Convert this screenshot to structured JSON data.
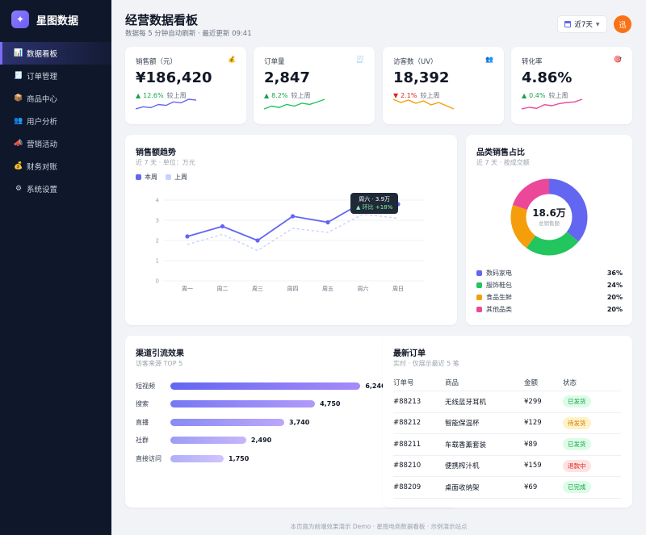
{
  "brand": {
    "logo_glyph": "✦",
    "name": "星图数据"
  },
  "sidebar": {
    "items": [
      {
        "label": "数据看板",
        "icon": "bar-chart-icon",
        "glyph": "📊",
        "active": true
      },
      {
        "label": "订单管理",
        "icon": "receipt-icon",
        "glyph": "🧾",
        "active": false
      },
      {
        "label": "商品中心",
        "icon": "package-icon",
        "glyph": "📦",
        "active": false
      },
      {
        "label": "用户分析",
        "icon": "users-icon",
        "glyph": "👥",
        "active": false
      },
      {
        "label": "营销活动",
        "icon": "megaphone-icon",
        "glyph": "📣",
        "active": false
      },
      {
        "label": "财务对账",
        "icon": "money-bag-icon",
        "glyph": "💰",
        "active": false
      },
      {
        "label": "系统设置",
        "icon": "gear-icon",
        "glyph": "⚙",
        "active": false
      }
    ]
  },
  "header": {
    "title": "经营数据看板",
    "subtitle": "数据每 5 分钟自动刷新 · 最近更新 09:41",
    "date_range": "近7天",
    "avatar_text": "迅"
  },
  "kpis": [
    {
      "label": "销售额（元）",
      "icon": "money-bag-icon",
      "glyph": "💰",
      "value": "¥186,420",
      "trend": "up",
      "arrow": "▲",
      "delta": "12.6%",
      "delta_suffix": "较上周",
      "color": "#6366f1",
      "spark": [
        4,
        5,
        4.6,
        6,
        5.6,
        7.2,
        6.8,
        8.4,
        8
      ]
    },
    {
      "label": "订单量",
      "icon": "receipt-icon",
      "glyph": "🧾",
      "value": "2,847",
      "trend": "up",
      "arrow": "▲",
      "delta": "8.2%",
      "delta_suffix": "较上周",
      "color": "#22c55e",
      "spark": [
        3,
        4,
        3.5,
        4.6,
        4,
        5,
        4.6,
        5.4,
        6.4
      ]
    },
    {
      "label": "访客数（UV）",
      "icon": "users-icon",
      "glyph": "👥",
      "value": "18,392",
      "trend": "down",
      "arrow": "▼",
      "delta": "2.1%",
      "delta_suffix": "较上周",
      "color": "#f59e0b",
      "spark": [
        7,
        6.2,
        6.8,
        6,
        6.6,
        5.6,
        6.2,
        5.4,
        4.6
      ]
    },
    {
      "label": "转化率",
      "icon": "target-icon",
      "glyph": "🎯",
      "value": "4.86%",
      "trend": "up",
      "arrow": "▲",
      "delta": "0.4%",
      "delta_suffix": "较上周",
      "color": "#ec4899",
      "spark": [
        4,
        4.3,
        4.1,
        4.8,
        4.6,
        5,
        5.2,
        5.3,
        5.8
      ]
    }
  ],
  "trend": {
    "title": "销售额趋势",
    "subtitle": "近 7 天 · 单位：万元",
    "legend": [
      {
        "name": "本周",
        "color": "#6366f1"
      },
      {
        "name": "上周",
        "color": "#c7d2fe"
      }
    ],
    "tooltip": {
      "line1": "周六 · 3.9万",
      "line2": "▲ 环比 +18%"
    }
  },
  "share": {
    "title": "品类销售占比",
    "subtitle": "近 7 天 · 按成交额",
    "center_value": "18.6万",
    "center_label": "总销售额",
    "segments": [
      {
        "name": "数码家电",
        "value": 36,
        "pct": "36%",
        "color": "#6366f1"
      },
      {
        "name": "服饰鞋包",
        "value": 24,
        "pct": "24%",
        "color": "#22c55e"
      },
      {
        "name": "食品生鲜",
        "value": 20,
        "pct": "20%",
        "color": "#f59e0b"
      },
      {
        "name": "其他品类",
        "value": 20,
        "pct": "20%",
        "color": "#ec4899"
      }
    ]
  },
  "channels": {
    "title": "渠道引流效果",
    "subtitle": "访客来源 TOP 5",
    "max": 7000,
    "rows": [
      {
        "label": "短视频",
        "value": 6240,
        "display": "6,240"
      },
      {
        "label": "搜索",
        "value": 4750,
        "display": "4,750"
      },
      {
        "label": "直播",
        "value": 3740,
        "display": "3,740"
      },
      {
        "label": "社群",
        "value": 2490,
        "display": "2,490"
      },
      {
        "label": "直接访问",
        "value": 1750,
        "display": "1,750"
      }
    ]
  },
  "orders": {
    "title": "最新订单",
    "subtitle": "实时 · 仅展示最近 5 笔",
    "columns": [
      "订单号",
      "商品",
      "金额",
      "状态"
    ],
    "rows": [
      {
        "id": "#88213",
        "product": "无线蓝牙耳机",
        "amount": "¥299",
        "status": "已发货",
        "fg": "#16a34a",
        "bg": "#dcfce7"
      },
      {
        "id": "#88212",
        "product": "智能保温杯",
        "amount": "¥129",
        "status": "待发货",
        "fg": "#d97706",
        "bg": "#fef3c7"
      },
      {
        "id": "#88211",
        "product": "车载香薰套装",
        "amount": "¥89",
        "status": "已发货",
        "fg": "#16a34a",
        "bg": "#dcfce7"
      },
      {
        "id": "#88210",
        "product": "便携榨汁机",
        "amount": "¥159",
        "status": "退款中",
        "fg": "#dc2626",
        "bg": "#fee2e2"
      },
      {
        "id": "#88209",
        "product": "桌面收纳架",
        "amount": "¥69",
        "status": "已完成",
        "fg": "#16a34a",
        "bg": "#dcfce7"
      }
    ]
  },
  "footer": "本页面为前端效果演示 Demo · 星图电商数据看板 · 示例演示站点",
  "chart_data": {
    "type": "line",
    "categories": [
      "周一",
      "周二",
      "周三",
      "周四",
      "周五",
      "周六",
      "周日"
    ],
    "series": [
      {
        "name": "本周",
        "values": [
          2.2,
          2.7,
          2.0,
          3.2,
          2.9,
          3.9,
          3.8
        ]
      },
      {
        "name": "上周",
        "values": [
          1.8,
          2.3,
          1.5,
          2.6,
          2.4,
          3.3,
          3.1
        ]
      }
    ],
    "title": "销售额趋势",
    "ylim": [
      0,
      4
    ],
    "yticks": [
      0,
      1,
      2,
      3,
      4
    ]
  }
}
